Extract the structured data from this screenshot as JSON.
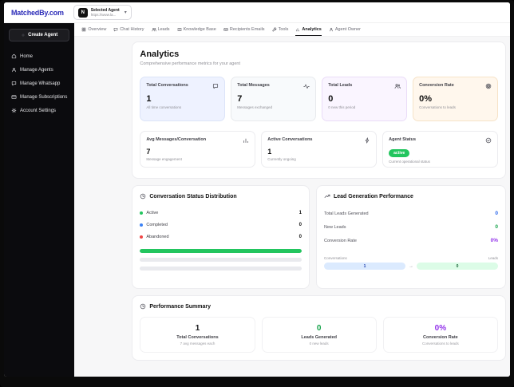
{
  "topbar": {
    "logo": "MatchedBy.com",
    "agent_selector": {
      "avatar": "N",
      "label": "Selected Agent",
      "value": "https://www.la...",
      "chevron": "▾"
    }
  },
  "sidebar": {
    "create_button": {
      "label": "Create Agent",
      "icon": "plus"
    },
    "items": [
      {
        "label": "Home",
        "icon": "home"
      },
      {
        "label": "Manage Agents",
        "icon": "user"
      },
      {
        "label": "Manage Whatsapp",
        "icon": "chat"
      },
      {
        "label": "Manage Subscriptions",
        "icon": "card"
      },
      {
        "label": "Account Settings",
        "icon": "gear"
      }
    ]
  },
  "tabs": [
    {
      "label": "Overview",
      "icon": "grid",
      "active": false
    },
    {
      "label": "Chat History",
      "icon": "chat",
      "active": false
    },
    {
      "label": "Leads",
      "icon": "users",
      "active": false
    },
    {
      "label": "Knowledge Base",
      "icon": "book",
      "active": false
    },
    {
      "label": "Recipients Emails",
      "icon": "mail",
      "active": false
    },
    {
      "label": "Tools",
      "icon": "wrench",
      "active": false
    },
    {
      "label": "Analytics",
      "icon": "chart",
      "active": true
    },
    {
      "label": "Agent Owner",
      "icon": "user",
      "active": false
    }
  ],
  "analytics": {
    "title": "Analytics",
    "subtitle": "Comprehensive performance metrics for your agent",
    "stat_cards": [
      {
        "label": "Total Conversations",
        "value": "1",
        "sub": "All time conversations",
        "icon": "chat",
        "bg": "#eef2ff",
        "border": "#dce4f8"
      },
      {
        "label": "Total Messages",
        "value": "7",
        "sub": "Messages exchanged",
        "icon": "activity",
        "bg": "#f8fafc",
        "border": "#e8eaed"
      },
      {
        "label": "Total Leads",
        "value": "0",
        "sub": "0 new this period",
        "icon": "users",
        "bg": "#faf5ff",
        "border": "#eadcf8"
      },
      {
        "label": "Conversion Rate",
        "value": "0%",
        "sub": "Conversations to leads",
        "icon": "target",
        "bg": "#fff7ed",
        "border": "#f6e3c8"
      }
    ],
    "secondary_cards": [
      {
        "label": "Avg Messages/Conversation",
        "value": "7",
        "sub": "Message engagement",
        "icon": "chart"
      },
      {
        "label": "Active Conversations",
        "value": "1",
        "sub": "Currently ongoing",
        "icon": "zap"
      },
      {
        "label": "Agent Status",
        "value": "active",
        "sub": "Current operational status",
        "icon": "check-circle",
        "status_color": "#22c55e"
      }
    ],
    "distribution": {
      "title": "Conversation Status Distribution",
      "icon": "clock",
      "rows": [
        {
          "label": "Active",
          "value": "1",
          "color": "#22c55e",
          "pct": 100
        },
        {
          "label": "Completed",
          "value": "0",
          "color": "#3b82f6",
          "pct": 0
        },
        {
          "label": "Abandoned",
          "value": "0",
          "color": "#ef4444",
          "pct": 0
        }
      ]
    },
    "lead_gen": {
      "title": "Lead Generation Performance",
      "icon": "trending",
      "rows": [
        {
          "label": "Total Leads Generated",
          "value": "0",
          "color": "#2563eb"
        },
        {
          "label": "New Leads",
          "value": "0",
          "color": "#16a34a"
        },
        {
          "label": "Conversion Rate",
          "value": "0%",
          "color": "#9333ea"
        }
      ],
      "funnel": {
        "left_label": "Conversations",
        "right_label": "Leads",
        "left_value": "1",
        "right_value": "0",
        "arrow": "→"
      }
    },
    "summary": {
      "title": "Performance Summary",
      "icon": "clock",
      "items": [
        {
          "value": "1",
          "color": "#18181b",
          "label": "Total Conversations",
          "sub": "7 avg messages each"
        },
        {
          "value": "0",
          "color": "#16a34a",
          "label": "Leads Generated",
          "sub": "0 new leads"
        },
        {
          "value": "0%",
          "color": "#9333ea",
          "label": "Conversion Rate",
          "sub": "Conversations to leads"
        }
      ]
    }
  },
  "colors": {
    "sidebar_bg": "#0b0b0e",
    "accent_green": "#22c55e",
    "accent_blue": "#2563eb",
    "accent_purple": "#9333ea",
    "accent_red": "#ef4444"
  }
}
